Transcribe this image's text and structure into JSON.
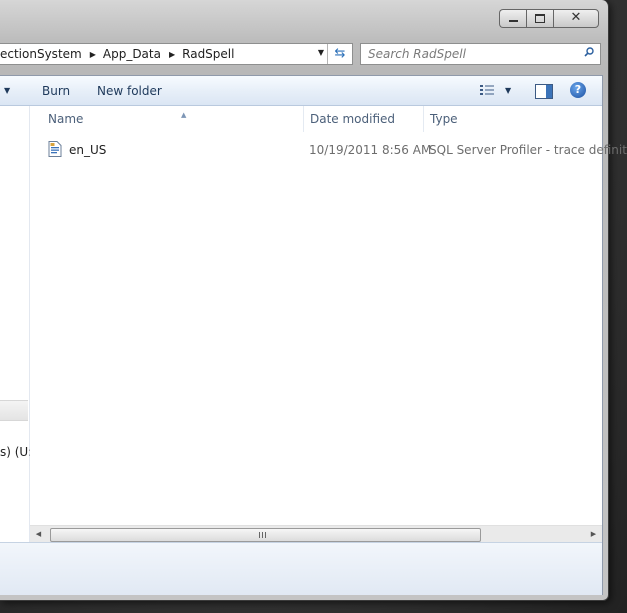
{
  "address_bar": {
    "crumbs": [
      {
        "label": "ectionSystem"
      },
      {
        "label": "App_Data"
      },
      {
        "label": "RadSpell"
      }
    ]
  },
  "search": {
    "placeholder": "Search RadSpell"
  },
  "toolbar": {
    "burn_label": "Burn",
    "new_folder_label": "New folder"
  },
  "columns": {
    "name": "Name",
    "date_modified": "Date modified",
    "type": "Type"
  },
  "files": [
    {
      "name": "en_US",
      "date_modified": "10/19/2011 8:56 AM",
      "type": "SQL Server Profiler - trace definiti"
    }
  ],
  "nav_pane": {
    "partial_text": "s) (U:"
  },
  "colors": {
    "toolbar_text": "#1e395b",
    "header_text": "#4c607a",
    "accent": "#3b73b9"
  },
  "icons": [
    "minimize-icon",
    "maximize-icon",
    "close-icon",
    "refresh-icon",
    "search-icon",
    "views-icon",
    "preview-pane-icon",
    "help-icon",
    "file-icon"
  ]
}
